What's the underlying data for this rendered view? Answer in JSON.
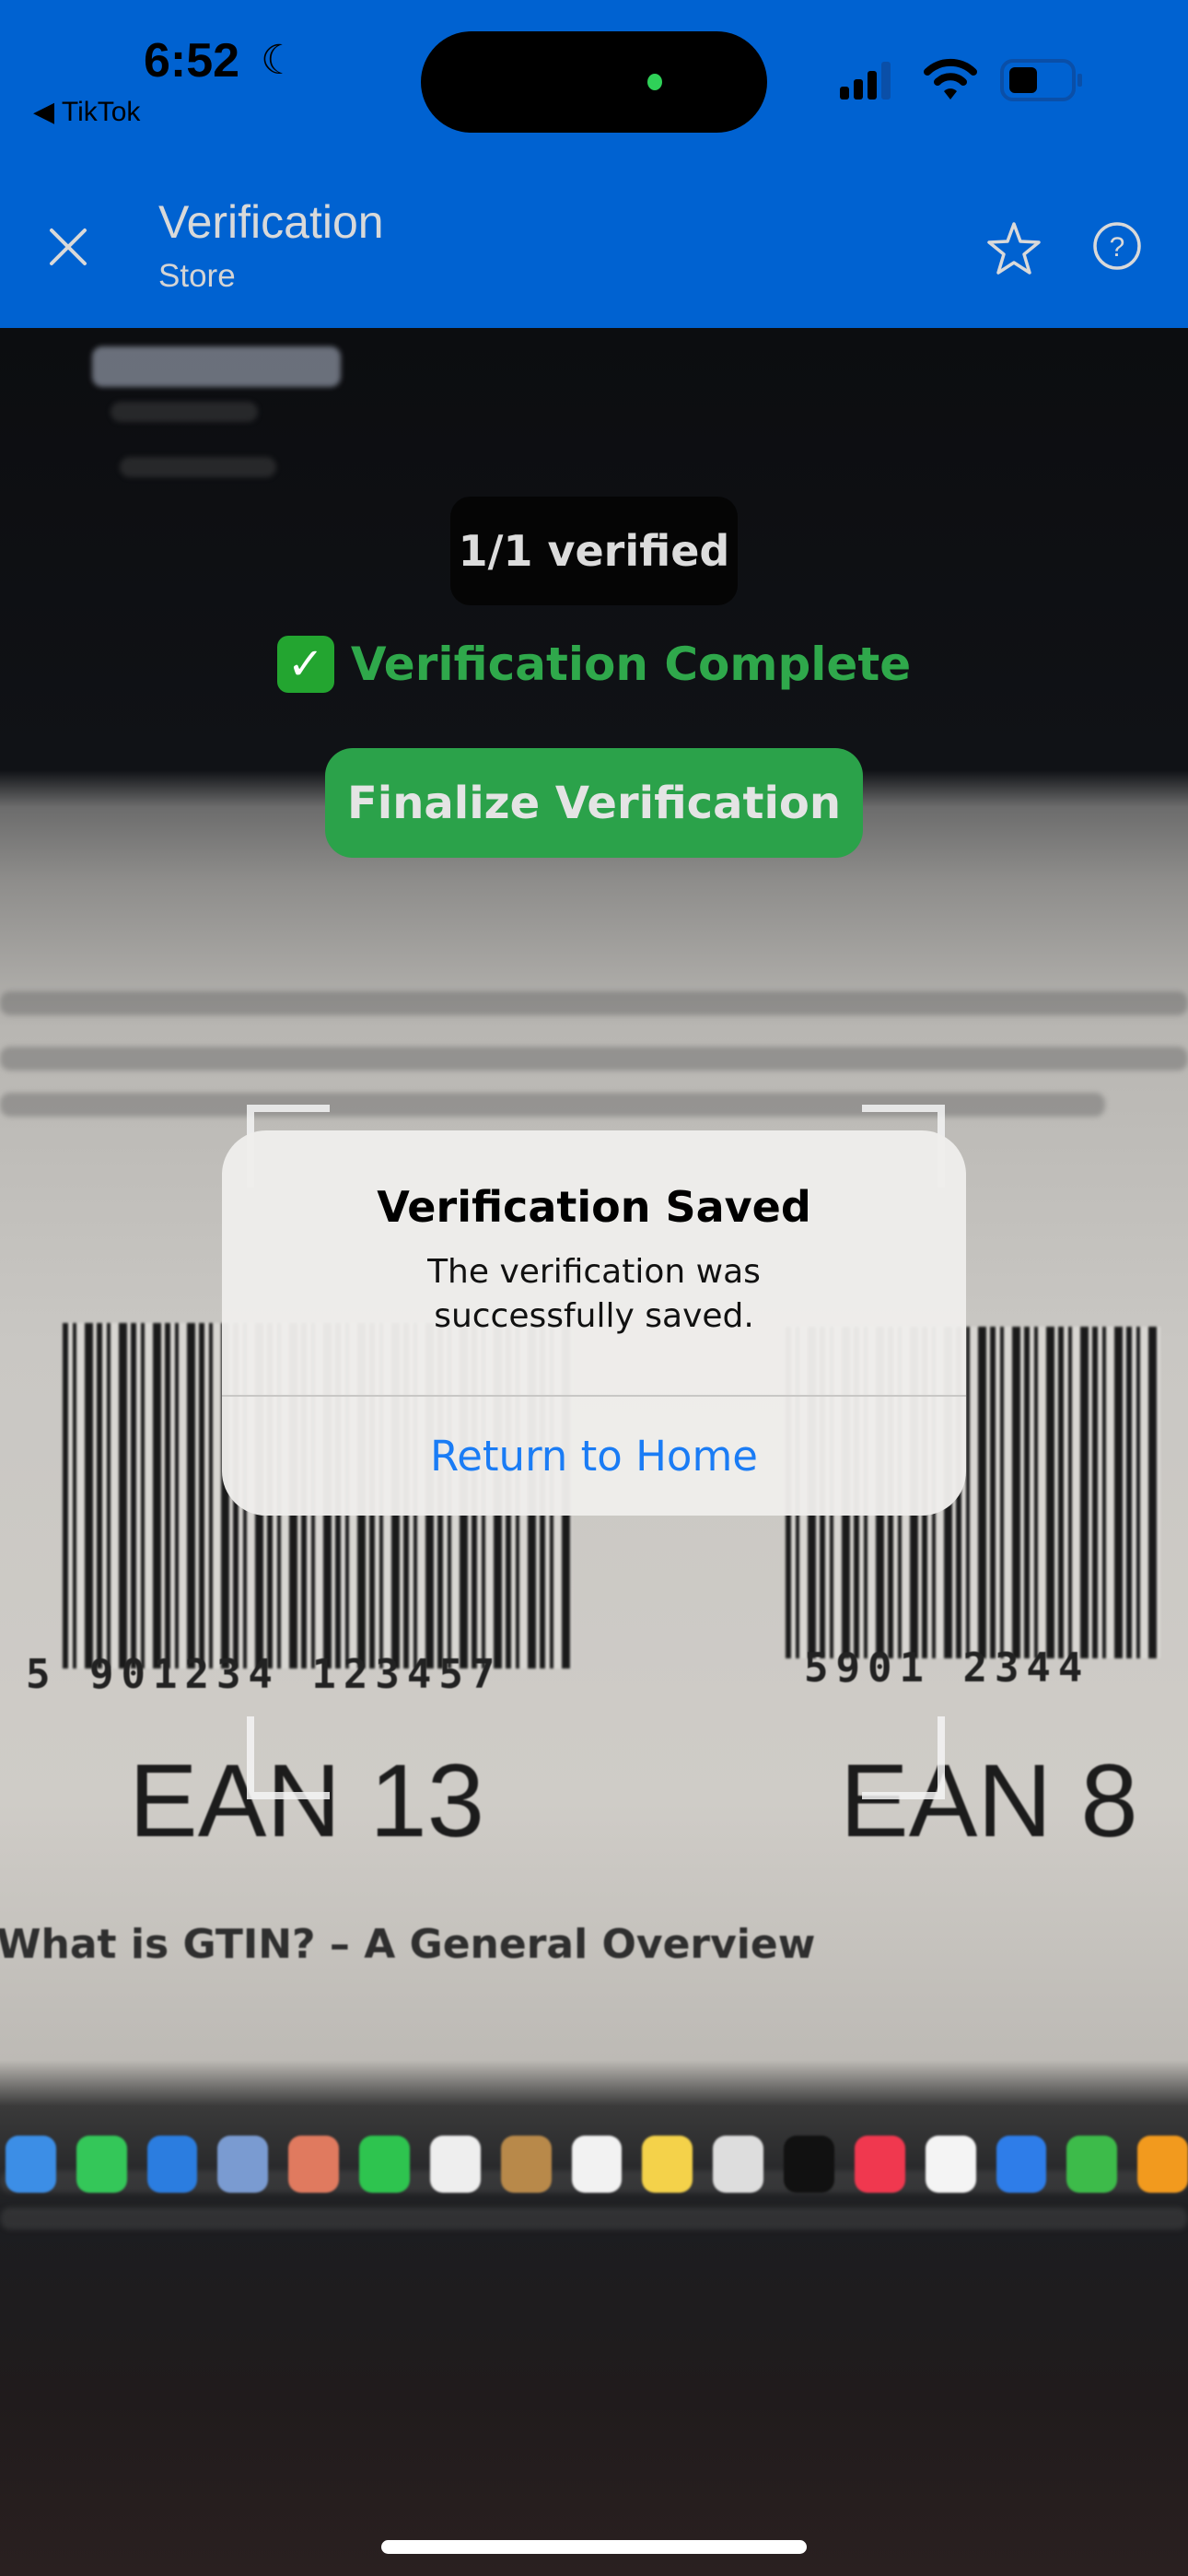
{
  "status_bar": {
    "time": "6:52",
    "back_app": "◀ TikTok",
    "focus_icon": "moon-icon",
    "signal_icon": "cellular-signal-icon",
    "wifi_icon": "wifi-icon",
    "battery_icon": "battery-icon"
  },
  "header": {
    "title": "Verification",
    "subtitle": "Store",
    "close_icon": "close-icon",
    "favorite_icon": "star-icon",
    "help_icon": "help-circle-icon",
    "background": "#0062d1"
  },
  "scanner": {
    "progress": "1/1 verified",
    "status": "Verification Complete",
    "status_icon": "check-mark-button-icon",
    "status_color": "#2fa84b",
    "finalize_label": "Finalize Verification",
    "finalize_color": "#2ba24a"
  },
  "alert": {
    "title": "Verification Saved",
    "message_line1": "The verification was",
    "message_line2": "successfully saved.",
    "button_label": "Return to Home",
    "button_color": "#1a7cf5"
  },
  "camera_view": {
    "left_digits": "5 901234 123457",
    "left_label": "EAN 13",
    "right_digits": "5901 2344",
    "right_label": "EAN 8",
    "heading": "What is GTIN? – A General Overview"
  }
}
